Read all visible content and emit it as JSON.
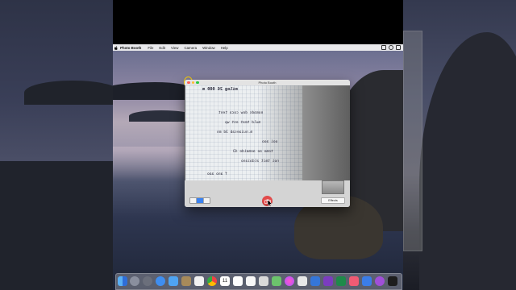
{
  "menubar": {
    "app_name": "Photo Booth",
    "items": [
      "File",
      "Edit",
      "View",
      "Camera",
      "Window",
      "Help"
    ]
  },
  "window": {
    "title": "Photo Booth",
    "effects_label": "Effects",
    "mode": "photo"
  },
  "handwriting": [
    "milog 26 000 m",
    "nomads dow coca tent",
    "muld tmat ent wp",
    "m.nuiaesab 3d mn",
    "ooi aoo",
    "tomo ao aomaido 43",
    "noi tmit aldaiano",
    "f ano aao"
  ],
  "dock": {
    "icons": [
      "finder-icon",
      "launchpad-icon",
      "rocket-icon",
      "safari-icon",
      "mail-icon",
      "photos-icon",
      "notes-icon",
      "chrome-icon",
      "calendar-icon",
      "keynote-icon",
      "reminders-icon",
      "preview-icon",
      "maps-icon",
      "messages-icon",
      "facetime-icon",
      "onenote-icon",
      "excel-icon",
      "music-icon",
      "podcasts-icon",
      "appletv-icon",
      "appstore-icon",
      "system-preferences-icon"
    ],
    "calendar_day": "11"
  },
  "colors": {
    "accent_blue": "#3b82f0",
    "shutter_red": "#e24a4a",
    "highlight_yellow": "#ffd200"
  }
}
